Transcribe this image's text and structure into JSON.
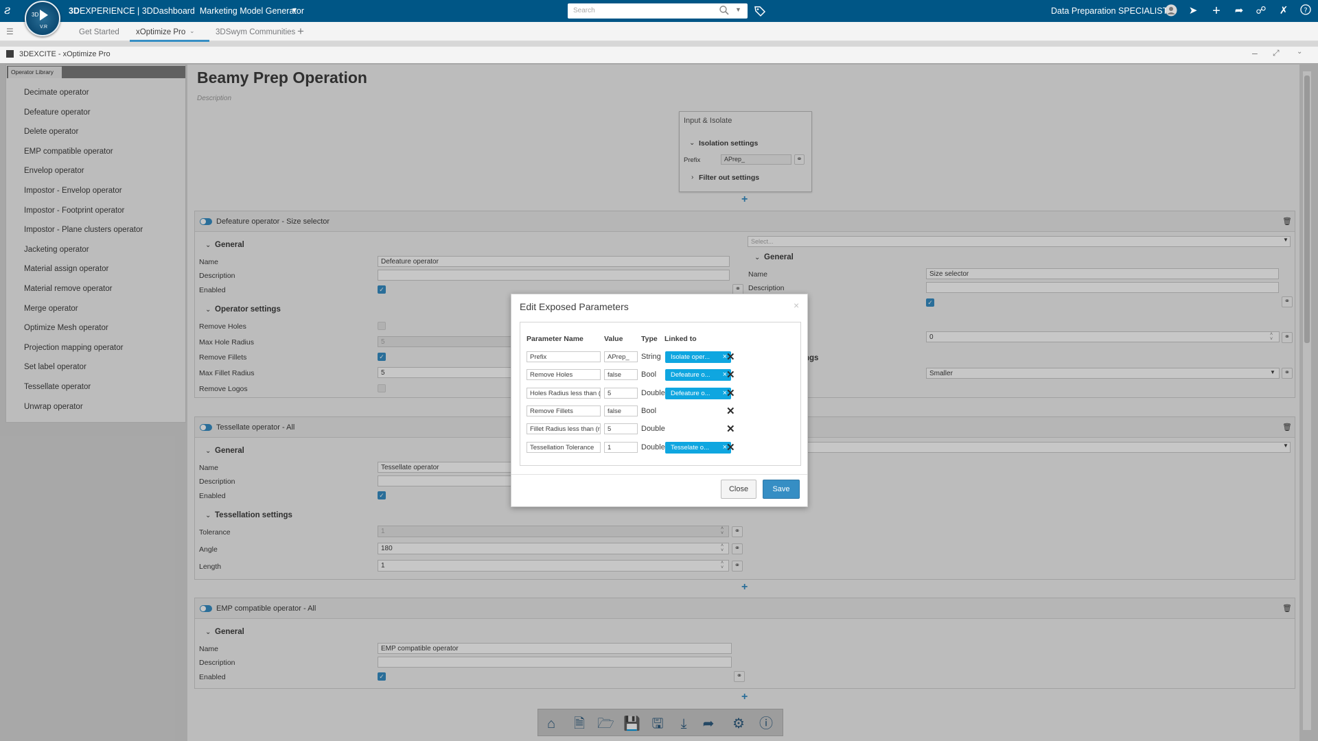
{
  "topbar": {
    "brand_bold": "3D",
    "brand_rest": "EXPERIENCE | 3DDashboard",
    "app_name": "Marketing Model Generator",
    "search_placeholder": "Search",
    "user_role": "Data Preparation SPECIALIST",
    "compass_label": "V.R"
  },
  "tabs": [
    {
      "label": "Get Started"
    },
    {
      "label": "xOptimize Pro"
    },
    {
      "label": "3DSwym Communities"
    }
  ],
  "widget": {
    "title": "3DEXCITE - xOptimize Pro"
  },
  "library": {
    "tab_label": "Operator Library",
    "items": [
      "Decimate operator",
      "Defeature operator",
      "Delete operator",
      "EMP compatible operator",
      "Envelop operator",
      "Impostor - Envelop operator",
      "Impostor - Footprint operator",
      "Impostor - Plane clusters operator",
      "Jacketing operator",
      "Material assign operator",
      "Material remove operator",
      "Merge operator",
      "Optimize Mesh operator",
      "Projection mapping operator",
      "Set label operator",
      "Tessellate operator",
      "Unwrap operator"
    ]
  },
  "page": {
    "title": "Beamy Prep Operation",
    "description": "Description"
  },
  "isolate": {
    "title": "Input & Isolate",
    "isolation_settings": "Isolation settings",
    "prefix_label": "Prefix",
    "prefix_value": "APrep_",
    "filter_settings": "Filter out settings"
  },
  "cards": {
    "defeature": {
      "title": "Defeature operator - Size selector",
      "general": "General",
      "name_label": "Name",
      "name_value": "Defeature operator",
      "desc_label": "Description",
      "enabled_label": "Enabled",
      "op_settings": "Operator settings",
      "remove_holes": "Remove Holes",
      "max_hole_radius": "Max Hole Radius",
      "max_hole_value": "5",
      "remove_fillets": "Remove Fillets",
      "max_fillet_radius": "Max Fillet Radius",
      "max_fillet_value": "5",
      "remove_logos": "Remove Logos",
      "select_placeholder": "Select...",
      "right_general": "General",
      "right_name_label": "Name",
      "right_name_value": "Size selector",
      "right_desc_label": "Description",
      "right_number": "0",
      "right_section_partial": "ngs",
      "right_select": "Smaller"
    },
    "tessellate": {
      "title": "Tessellate operator - All",
      "general": "General",
      "name_label": "Name",
      "name_value": "Tessellate operator",
      "desc_label": "Description",
      "enabled_label": "Enabled",
      "settings": "Tessellation settings",
      "tolerance_label": "Tolerance",
      "tolerance_value": "1",
      "angle_label": "Angle",
      "angle_value": "180",
      "length_label": "Length",
      "length_value": "1"
    },
    "emp": {
      "title": "EMP compatible operator - All",
      "general": "General",
      "name_label": "Name",
      "name_value": "EMP compatible operator",
      "desc_label": "Description",
      "enabled_label": "Enabled"
    }
  },
  "dialog": {
    "title": "Edit Exposed Parameters",
    "headers": {
      "name": "Parameter Name",
      "value": "Value",
      "type": "Type",
      "linked": "Linked to"
    },
    "rows": [
      {
        "name": "Prefix",
        "value": "APrep_",
        "type": "String",
        "linked": "Isolate oper..."
      },
      {
        "name": "Remove Holes",
        "value": "false",
        "type": "Bool",
        "linked": "Defeature o..."
      },
      {
        "name": "Holes Radius less than (mm)",
        "value": "5",
        "type": "Double",
        "linked": "Defeature o..."
      },
      {
        "name": "Remove Fillets",
        "value": "false",
        "type": "Bool",
        "linked": ""
      },
      {
        "name": "Fillet Radius less than (mm)",
        "value": "5",
        "type": "Double",
        "linked": ""
      },
      {
        "name": "Tessellation Tolerance",
        "value": "1",
        "type": "Double",
        "linked": "Tesselate o..."
      }
    ],
    "close_label": "Close",
    "save_label": "Save"
  },
  "colors": {
    "topbar": "#005686",
    "accent": "#368ec4",
    "chip": "#0fa6e0"
  }
}
